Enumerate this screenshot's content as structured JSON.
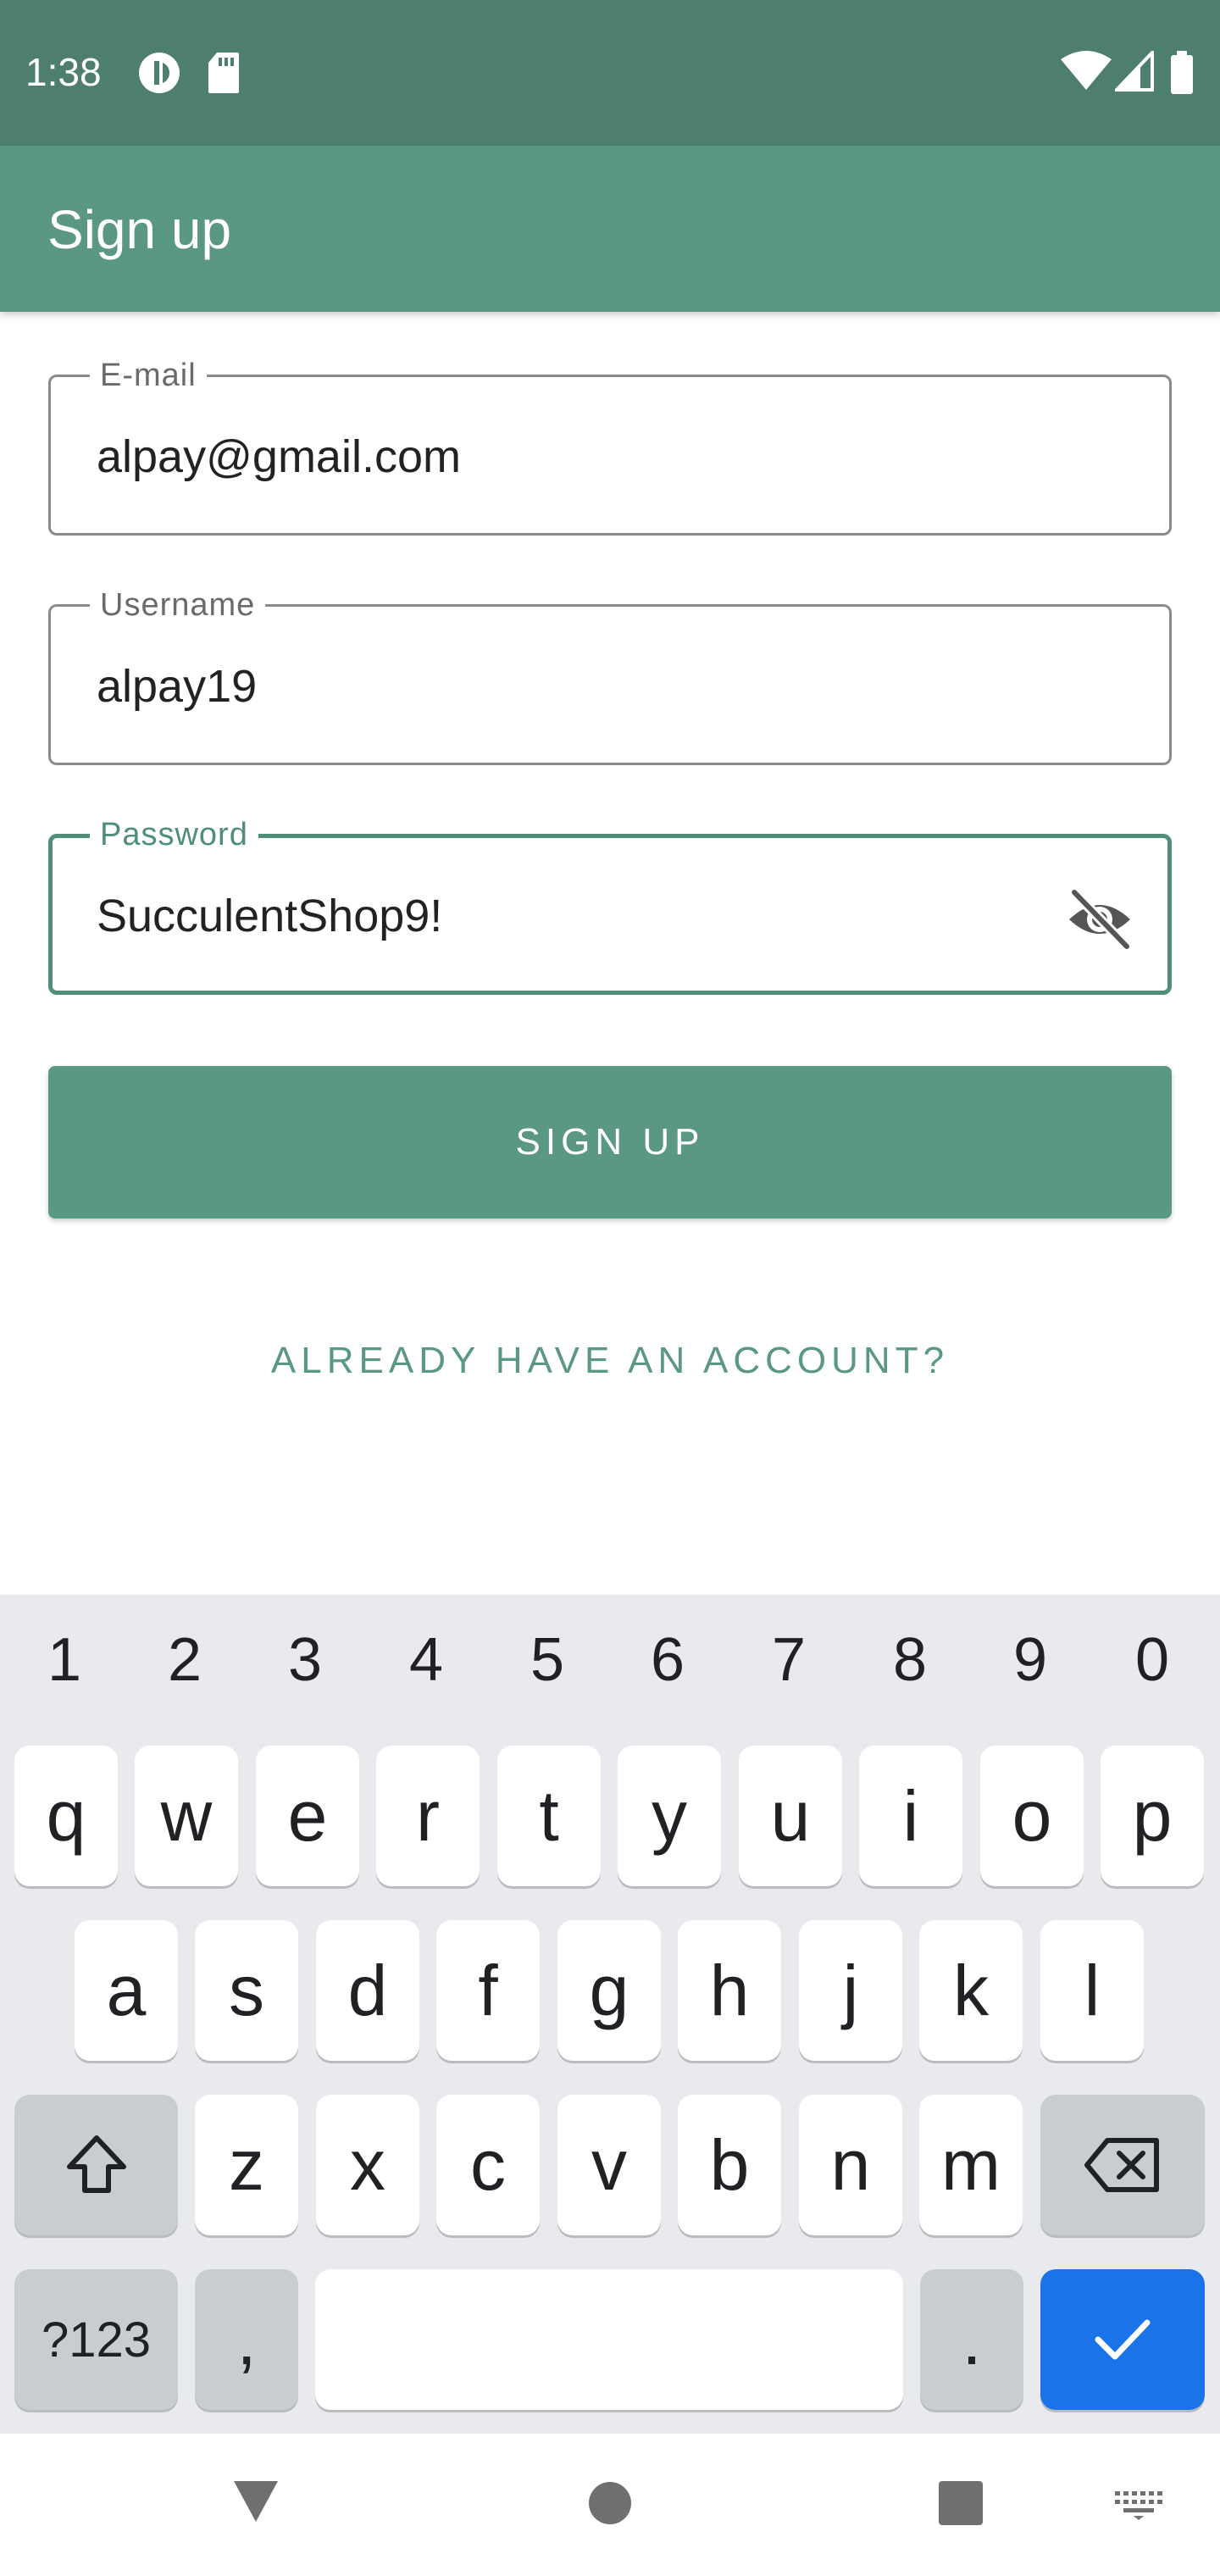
{
  "status_bar": {
    "time": "1:38",
    "icons": [
      "data-saver-icon",
      "sd-card-icon",
      "wifi-icon",
      "signal-icon",
      "battery-icon"
    ]
  },
  "app_bar": {
    "title": "Sign up"
  },
  "form": {
    "email": {
      "label": "E-mail",
      "value": "alpay@gmail.com"
    },
    "username": {
      "label": "Username",
      "value": "alpay19"
    },
    "password": {
      "label": "Password",
      "value": "SucculentShop9!",
      "toggle_icon": "visibility-off-icon"
    },
    "signup_button": "SIGN UP",
    "login_link": "ALREADY HAVE AN ACCOUNT?"
  },
  "keyboard": {
    "numbers": [
      "1",
      "2",
      "3",
      "4",
      "5",
      "6",
      "7",
      "8",
      "9",
      "0"
    ],
    "row1": [
      "q",
      "w",
      "e",
      "r",
      "t",
      "y",
      "u",
      "i",
      "o",
      "p"
    ],
    "row2": [
      "a",
      "s",
      "d",
      "f",
      "g",
      "h",
      "j",
      "k",
      "l"
    ],
    "row3": [
      "z",
      "x",
      "c",
      "v",
      "b",
      "n",
      "m"
    ],
    "symbols_key": "?123",
    "comma_key": ",",
    "period_key": ".",
    "shift_icon": "shift-icon",
    "backspace_icon": "backspace-icon",
    "enter_icon": "checkmark-icon"
  },
  "nav_bar": {
    "icons": [
      "back-icon",
      "home-icon",
      "recents-icon",
      "keyboard-switch-icon"
    ]
  },
  "colors": {
    "status_bar": "#4e7f6e",
    "primary": "#5a9784",
    "focus": "#4f8f78",
    "keyboard_bg": "#e8eaed",
    "enter_key": "#1a73e8"
  }
}
